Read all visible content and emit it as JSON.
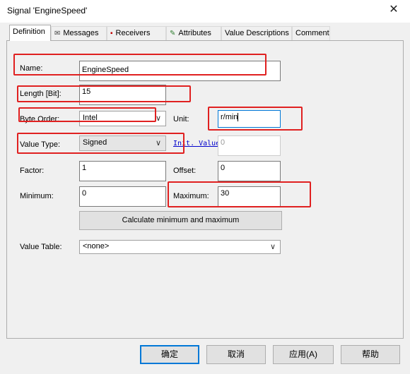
{
  "window": {
    "title": "Signal 'EngineSpeed'",
    "close_glyph": "✕"
  },
  "tabs": [
    {
      "label": "Definition",
      "icon": ""
    },
    {
      "label": "Messages",
      "icon": "envelope-icon"
    },
    {
      "label": "Receivers",
      "icon": "receiver-icon"
    },
    {
      "label": "Attributes",
      "icon": "attributes-icon"
    },
    {
      "label": "Value Descriptions",
      "icon": ""
    },
    {
      "label": "Comment",
      "icon": ""
    }
  ],
  "form": {
    "name_label": "Name:",
    "name_value": "EngineSpeed",
    "length_label": "Length [Bit]:",
    "length_value": "15",
    "byte_order_label": "Byte Order:",
    "byte_order_value": "Intel",
    "unit_label": "Unit:",
    "unit_value": "r/min",
    "value_type_label": "Value Type:",
    "value_type_value": "Signed",
    "init_value_label": "Init. Value",
    "init_value": "0",
    "factor_label": "Factor:",
    "factor_value": "1",
    "offset_label": "Offset:",
    "offset_value": "0",
    "minimum_label": "Minimum:",
    "minimum_value": "0",
    "maximum_label": "Maximum:",
    "maximum_value": "30",
    "calc_button": "Calculate minimum and maximum",
    "value_table_label": "Value Table:",
    "value_table_value": "<none>"
  },
  "buttons": {
    "ok": "确定",
    "cancel": "取消",
    "apply": "应用(A)",
    "help": "帮助"
  },
  "colors": {
    "highlight": "#e02020",
    "default_button_border": "#0078d7",
    "link": "#0000cc"
  }
}
